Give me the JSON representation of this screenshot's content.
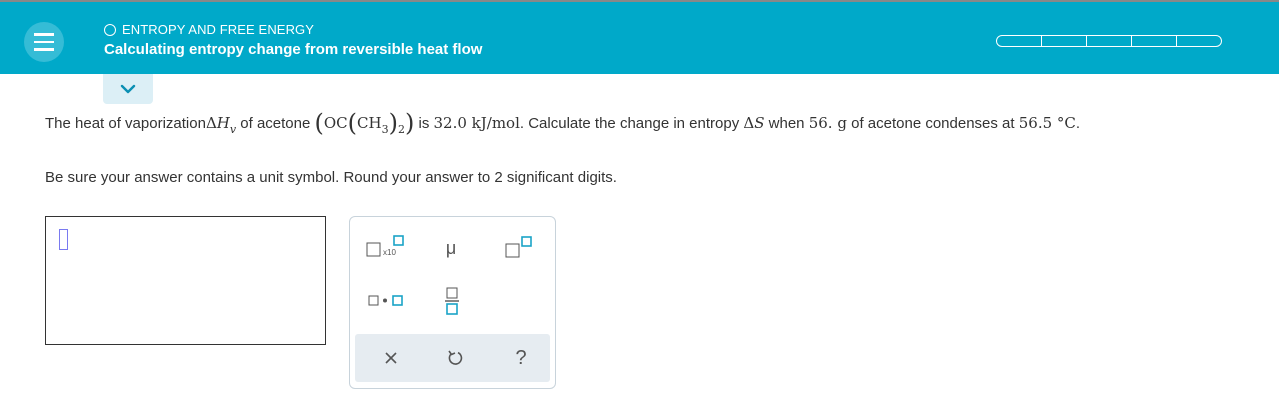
{
  "header": {
    "menu_icon": "hamburger-icon",
    "topic": "ENTROPY AND FREE ENERGY",
    "title": "Calculating entropy change from reversible heat flow",
    "progress_segments": 5,
    "progress_filled": 0
  },
  "colors": {
    "header_bg": "#00a9c9",
    "header_text": "#ffffff",
    "caret": "#7a7af0",
    "palette_bar": "#e6ecf1"
  },
  "question": {
    "p1": "The heat of vaporization ",
    "delta_h": "ΔH",
    "h_sub": "v",
    "p2": " of acetone ",
    "formula_oc": "OC",
    "formula_ch": "CH",
    "sub_3": "3",
    "sub_2": "2",
    "p3": " is ",
    "value": "32.0 kJ/mol",
    "p4": ". Calculate the change in entropy ",
    "delta_s": "ΔS",
    "p5": " when ",
    "mass": "56. g",
    "p6": " of acetone condenses at ",
    "temp": "56.5 °C",
    "p7": "."
  },
  "instructions": "Be sure your answer contains a unit symbol. Round your answer to 2 significant digits.",
  "answer": {
    "value": ""
  },
  "palette": {
    "sci_notation_label": "x10",
    "mu_symbol": "μ",
    "icons": [
      "sci-notation-icon",
      "mu-icon",
      "superscript-icon",
      "multiply-dot-icon",
      "fraction-icon",
      "clear-icon",
      "undo-icon",
      "help-icon"
    ],
    "help_symbol": "?"
  }
}
